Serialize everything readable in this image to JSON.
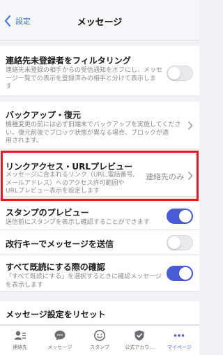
{
  "header": {
    "back_label": "設定",
    "title": "メッセージ"
  },
  "settings": {
    "filter_unregistered": {
      "title": "連絡先未登録者をフィルタリング",
      "desc_lines": [
        "連絡先未登録の相手からの受信通知をオフにし、メッセ",
        "ージ一覧での表示を登録済みの相手と分けて表示しま",
        "す"
      ],
      "enabled": false
    },
    "backup_restore": {
      "title": "バックアップ・復元",
      "desc_lines": [
        "機種変更の前には必ず旧端末でバックアップを実施してくださ",
        "い。復元前後でブロック状態が異なる場合、ブロックが適",
        "用されます。"
      ]
    },
    "link_access": {
      "title": "リンクアクセス・URLプレビュー",
      "desc_lines": [
        "メッセージに含まれるリンク（URL,電話番号,",
        "メールアドレス）へのアクセス許可範囲や",
        "URLプレビュー表示を設定します"
      ],
      "value": "連絡先のみ"
    },
    "stamp_preview": {
      "title": "スタンプのプレビュー",
      "desc_lines": [
        "送信前にスタンプを表示し確認することができます"
      ],
      "enabled": true
    },
    "enter_to_send": {
      "title": "改行キーでメッセージを送信",
      "enabled": false
    },
    "mark_all_read_confirm": {
      "title": "すべて既読にする際の確認",
      "desc_lines": [
        "「すべて既読にする」を選択するときに確認メッセージ",
        "を表示します"
      ],
      "enabled": true
    },
    "reset": {
      "title": "メッセージ設定をリセット"
    }
  },
  "tabbar": {
    "items": [
      {
        "label": "連絡先",
        "icon": "contacts-icon"
      },
      {
        "label": "メッセージ",
        "icon": "message-icon"
      },
      {
        "label": "スタンプ",
        "icon": "stamp-icon"
      },
      {
        "label": "公式アカウ…",
        "icon": "official-account-icon"
      },
      {
        "label": "マイページ",
        "icon": "mypage-icon"
      }
    ],
    "active_index": 4
  },
  "colors": {
    "accent": "#4a5bd6",
    "link": "#3a6fd8",
    "highlight_border": "#e8181f",
    "toggle_off": "#e9e9ec"
  }
}
